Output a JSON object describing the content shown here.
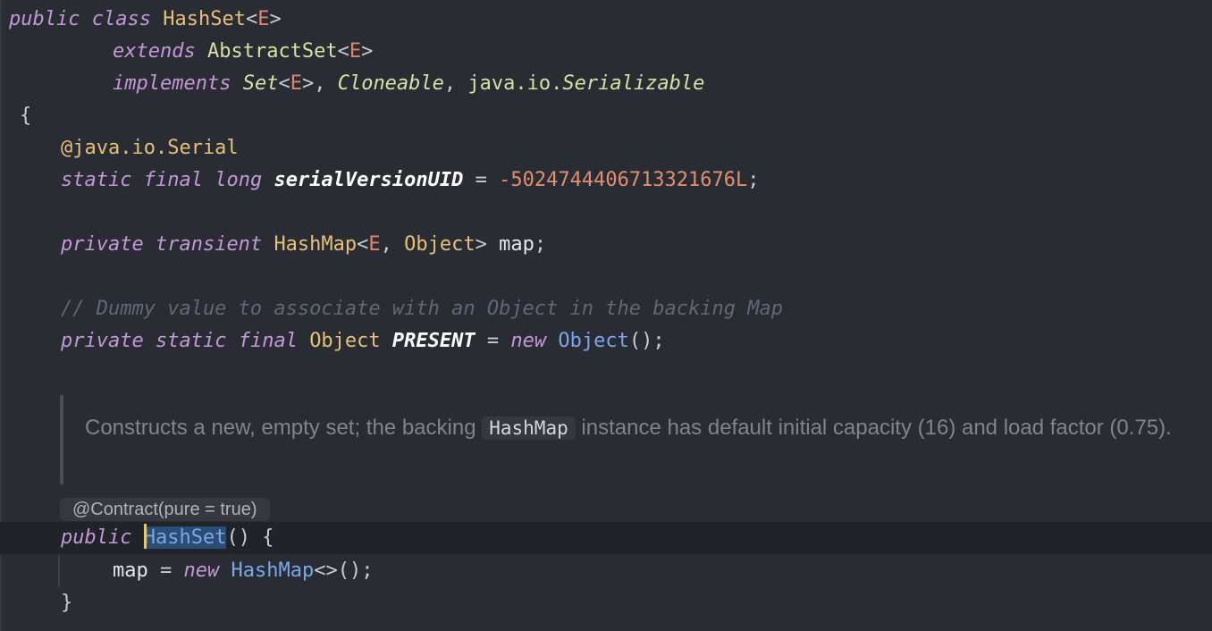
{
  "code": {
    "l1": {
      "public": "public",
      "class": "class",
      "name": "HashSet",
      "lt": "<",
      "E": "E",
      "gt": ">"
    },
    "l2": {
      "extends": "extends",
      "super": "AbstractSet",
      "lt": "<",
      "E": "E",
      "gt": ">"
    },
    "l3": {
      "implements": "implements",
      "set": "Set",
      "lt": "<",
      "E": "E",
      "gt": ">",
      "comma1": ",",
      "cloneable": "Cloneable",
      "comma2": ",",
      "pkg": "java.io.",
      "serializable": "Serializable"
    },
    "l4": {
      "brace": "{"
    },
    "l5": {
      "annotation": "@java.io.Serial"
    },
    "l6": {
      "static": "static",
      "final": "final",
      "long": "long",
      "field": "serialVersionUID",
      "eq": " = ",
      "value": "-5024744406713321676L",
      "semi": ";"
    },
    "l7": {
      "private": "private",
      "transient": "transient",
      "type": "HashMap",
      "lt": "<",
      "E": "E",
      "comma": ",",
      "obj": "Object",
      "gt": ">",
      "field": "map",
      "semi": ";"
    },
    "l8": {
      "comment": "// Dummy value to associate with an Object in the backing Map"
    },
    "l9": {
      "private": "private",
      "static": "static",
      "final": "final",
      "type": "Object",
      "field": "PRESENT",
      "eq": " = ",
      "new": "new",
      "ctor": "Object",
      "parens": "();"
    },
    "doc": {
      "before": "Constructs a new, empty set; the backing ",
      "chip": "HashMap",
      "after": " instance has default initial capacity (16) and load factor (0.75)."
    },
    "contract_hint": "@Contract(pure = true)",
    "l10": {
      "public": "public",
      "name": "HashSet",
      "rest": "() {"
    },
    "l11": {
      "field": "map",
      "eq": " = ",
      "new": "new",
      "ctor": "HashMap",
      "rest": "<>();"
    },
    "l12": {
      "brace": "}"
    }
  }
}
